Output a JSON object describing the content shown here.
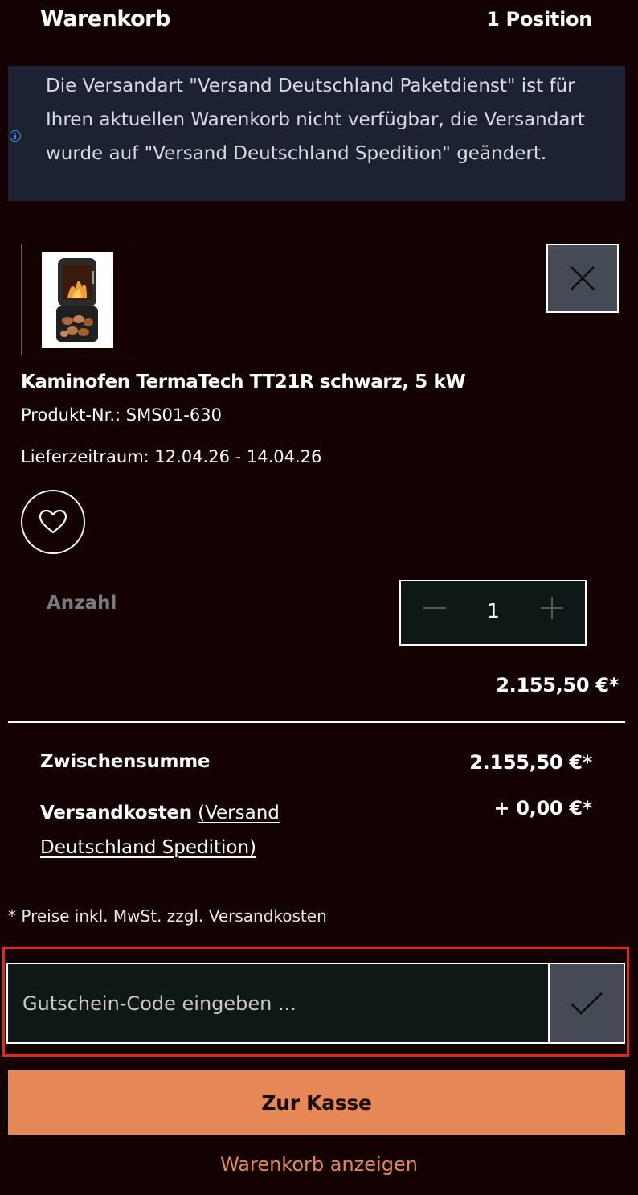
{
  "header": {
    "title": "Warenkorb",
    "count": "1 Position"
  },
  "banner": {
    "icon": "info-icon",
    "text": "Die Versandart \"Versand Deutschland Paketdienst\" ist für Ihren aktuellen Warenkorb nicht verfügbar, die Versandart wurde auf \"Versand Deutschland Spedition\" geändert."
  },
  "product": {
    "name": "Kaminofen TermaTech TT21R schwarz, 5 kW",
    "number": "Produkt-Nr.: SMS01-630",
    "delivery": "Lieferzeitraum: 12.04.26 - 14.04.26",
    "quantity_label": "Anzahl",
    "quantity": "1",
    "price": "2.155,50 €*"
  },
  "summary": {
    "subtotal_label": "Zwischensumme",
    "subtotal_value": "2.155,50 €*",
    "shipping_label": "Versandkosten",
    "shipping_link": "(Versand Deutschland Spedition)",
    "shipping_value": "+ 0,00 €*"
  },
  "footnote": "* Preise inkl. MwSt. zzgl. Versandkosten",
  "voucher": {
    "placeholder": "Gutschein-Code eingeben ...",
    "value": ""
  },
  "actions": {
    "checkout": "Zur Kasse",
    "view_cart": "Warenkorb anzeigen"
  },
  "colors": {
    "background": "#140203",
    "banner": "#1d2233",
    "accent": "#e58855",
    "button_grey": "#454b55",
    "highlight_border": "#e0281e"
  }
}
